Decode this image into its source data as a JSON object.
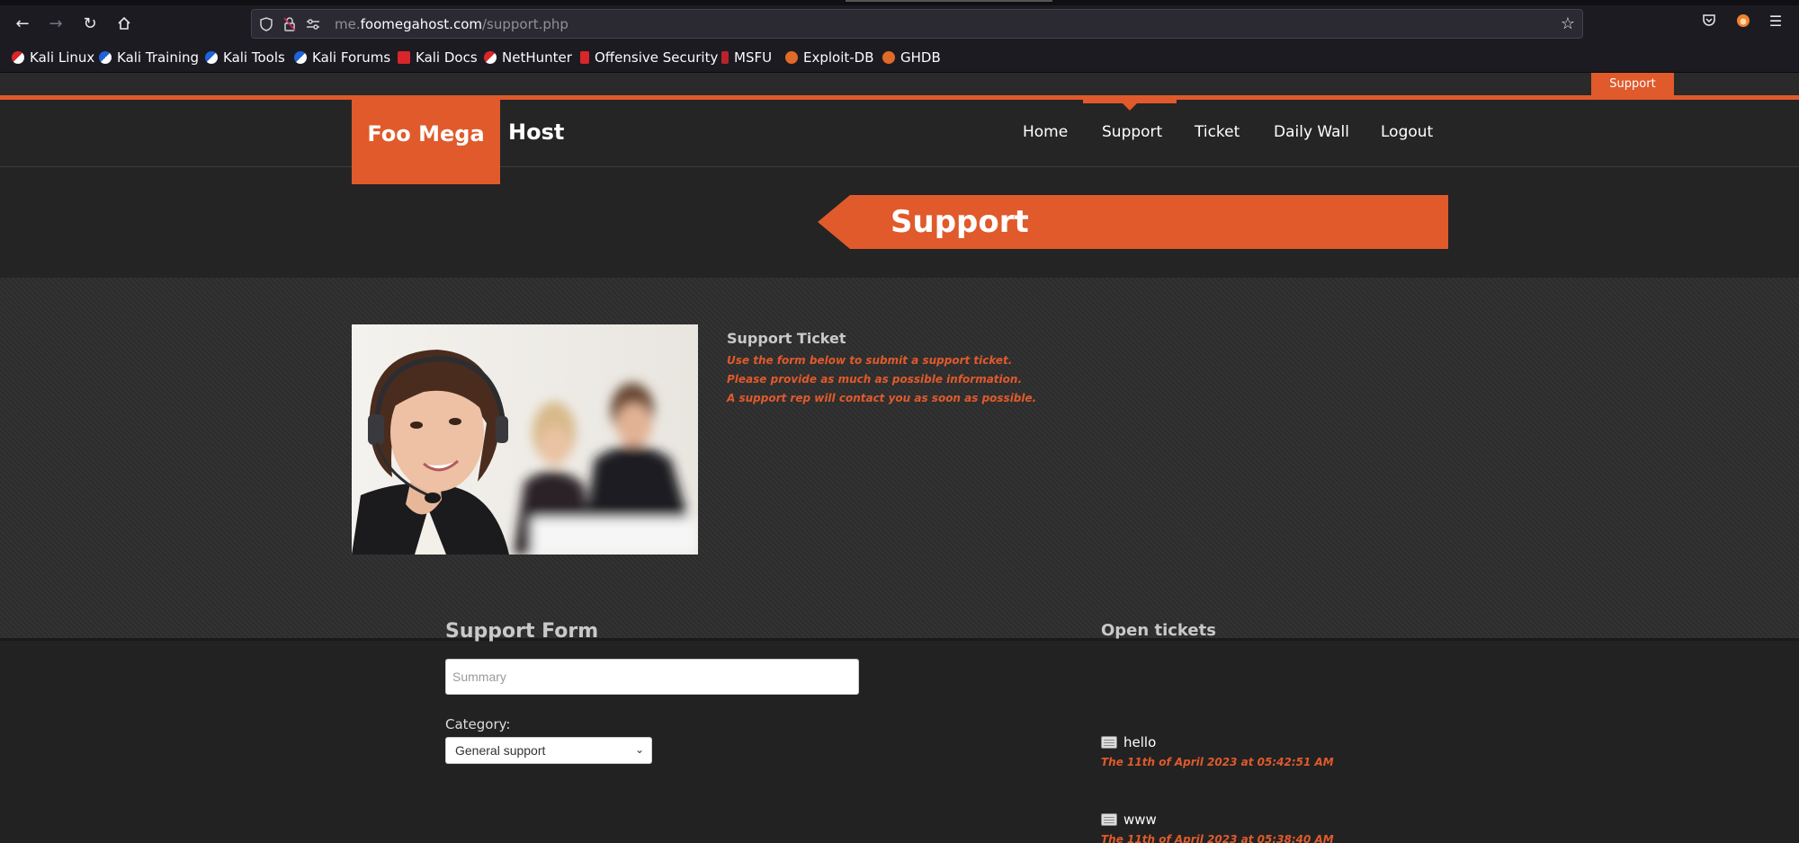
{
  "browser": {
    "url_prefix": "me.",
    "url_host": "foomegahost.com",
    "url_path": "/support.php",
    "bookmarks": [
      {
        "label": "Kali Linux"
      },
      {
        "label": "Kali Training"
      },
      {
        "label": "Kali Tools"
      },
      {
        "label": "Kali Forums"
      },
      {
        "label": "Kali Docs"
      },
      {
        "label": "NetHunter"
      },
      {
        "label": "Offensive Security"
      },
      {
        "label": "MSFU"
      },
      {
        "label": "Exploit-DB"
      },
      {
        "label": "GHDB"
      }
    ]
  },
  "site": {
    "top_tab": "Support",
    "logo_left": "Foo Mega",
    "logo_right": "Host",
    "nav": [
      {
        "label": "Home"
      },
      {
        "label": "Support"
      },
      {
        "label": "Ticket"
      },
      {
        "label": "Daily Wall"
      },
      {
        "label": "Logout"
      }
    ],
    "banner_title": "Support"
  },
  "intro": {
    "title": "Support Ticket",
    "lines": [
      "Use the form below to submit a support ticket.",
      "Please provide as much as possible information.",
      "A support rep will contact you as soon as possible."
    ]
  },
  "form": {
    "title": "Support Form",
    "summary_placeholder": "Summary",
    "category_label": "Category:",
    "category_selected": "General support"
  },
  "open_tickets": {
    "title": "Open tickets",
    "items": [
      {
        "name": "hello",
        "date": "The 11th of April 2023 at 05:42:51 AM"
      },
      {
        "name": "www",
        "date": "The 11th of April 2023 at 05:38:40 AM"
      }
    ]
  },
  "colors": {
    "accent": "#e05a2b",
    "background": "#252525"
  }
}
